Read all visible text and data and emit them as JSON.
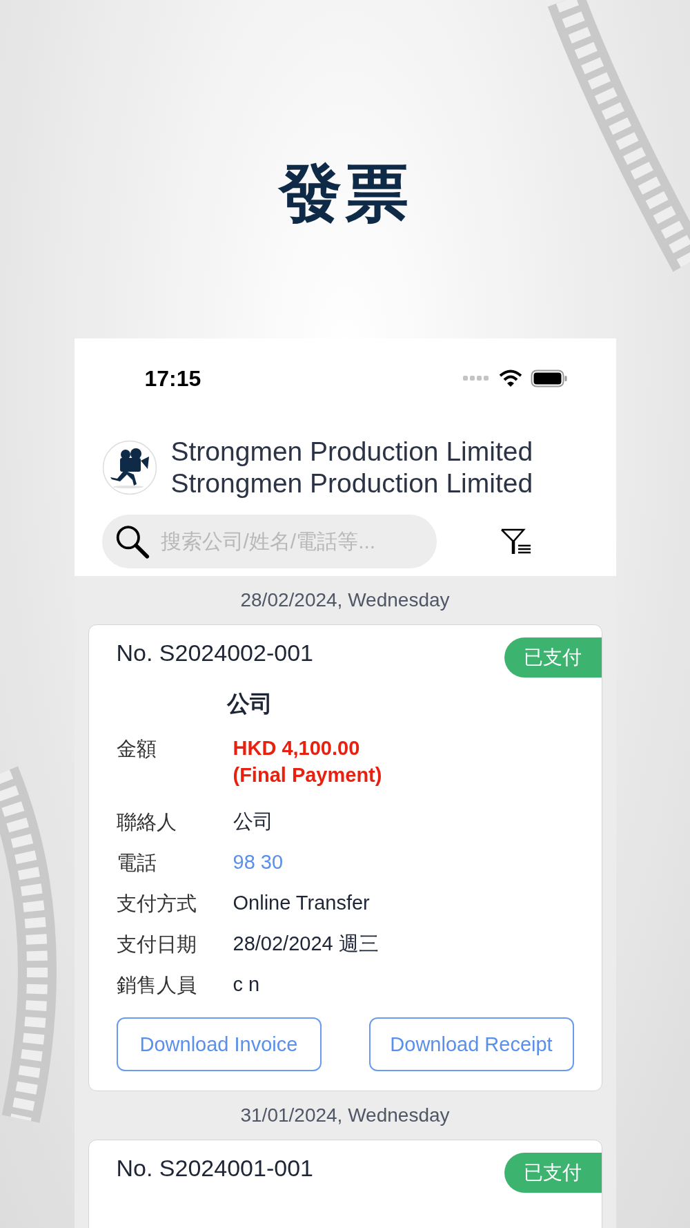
{
  "page_title": "發票",
  "status_bar": {
    "time": "17:15"
  },
  "header": {
    "company_lines": [
      "Strongmen Production Limited",
      "Strongmen Production Limited"
    ]
  },
  "search": {
    "placeholder": "搜索公司/姓名/電話等..."
  },
  "groups": [
    {
      "date": "28/02/2024, Wednesday",
      "invoice": {
        "number": "No. S2024002-001",
        "status": "已支付",
        "company": "公司",
        "fields": [
          {
            "label": "金額",
            "kind": "amount",
            "lines": [
              "HKD 4,100.00",
              "(Final Payment)"
            ]
          },
          {
            "label": "聯絡人",
            "kind": "plain",
            "lines": [
              "公司"
            ]
          },
          {
            "label": "電話",
            "kind": "phone",
            "lines": [
              "98 30"
            ]
          },
          {
            "label": "支付方式",
            "kind": "plain",
            "lines": [
              "Online Transfer"
            ]
          },
          {
            "label": "支付日期",
            "kind": "plain",
            "lines": [
              "28/02/2024 週三"
            ]
          },
          {
            "label": "銷售人員",
            "kind": "plain",
            "lines": [
              "c n"
            ]
          }
        ],
        "buttons": [
          "Download Invoice",
          "Download Receipt"
        ]
      }
    },
    {
      "date": "31/01/2024, Wednesday",
      "invoice": {
        "number": "No. S2024001-001",
        "status": "已支付"
      }
    }
  ]
}
